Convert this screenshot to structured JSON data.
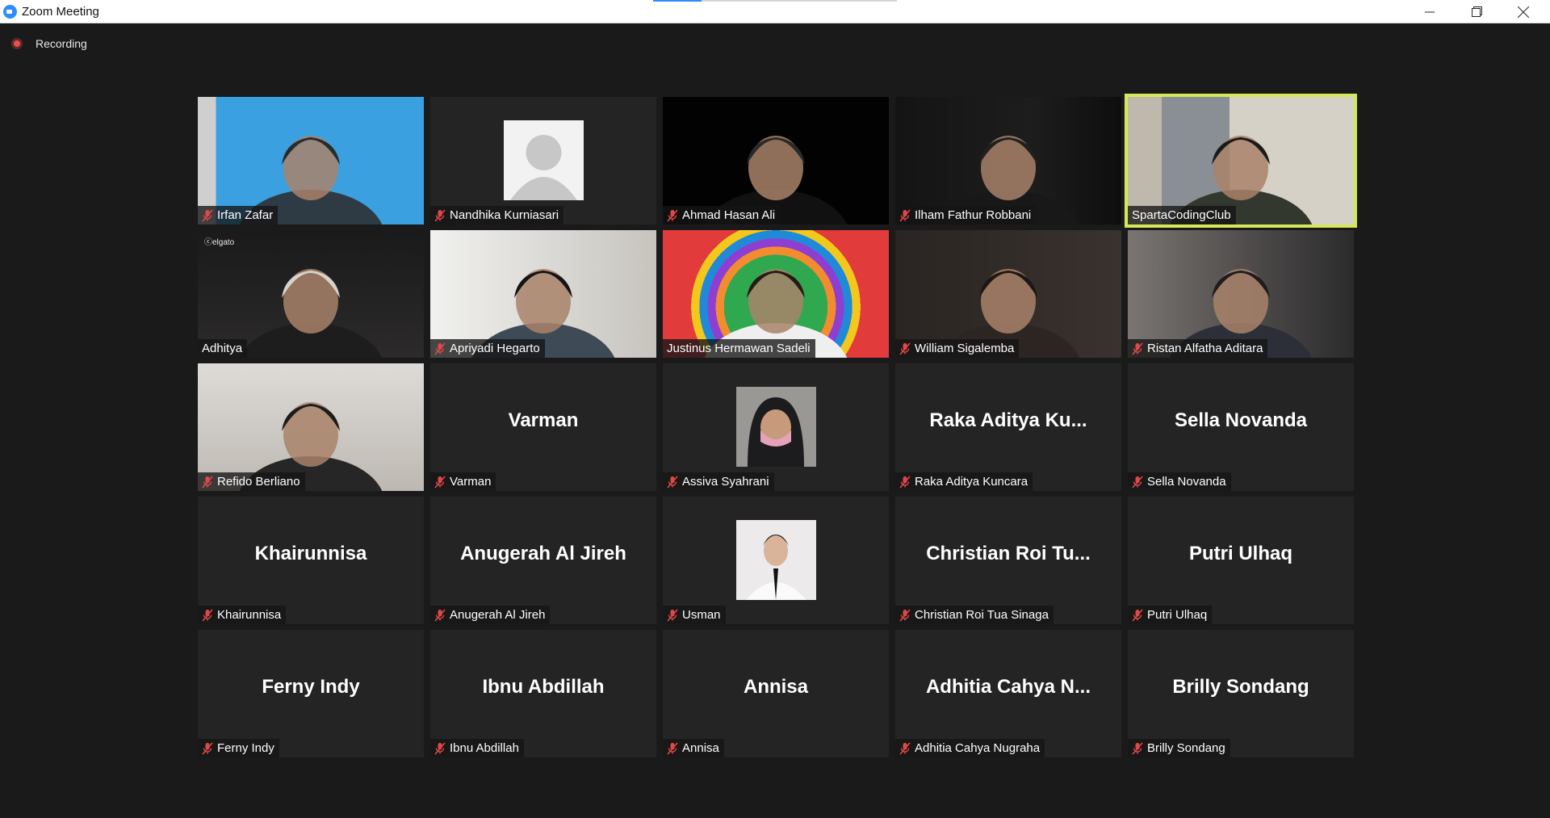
{
  "window": {
    "title": "Zoom Meeting"
  },
  "recording": {
    "label": "Recording"
  },
  "overlay": {
    "brand": "elgato"
  },
  "colors": {
    "active_speaker": "#d6e85a",
    "recording": "#f04d4d",
    "mute": "#e04848"
  },
  "tiles": [
    {
      "name": "Irfan Zafar",
      "muted": true
    },
    {
      "name": "Nandhika Kurniasari",
      "muted": true
    },
    {
      "name": "Ahmad Hasan Ali",
      "muted": true
    },
    {
      "name": "Ilham Fathur Robbani",
      "muted": true
    },
    {
      "name": "SpartaCodingClub",
      "muted": false,
      "active": true
    },
    {
      "name": "Adhitya",
      "muted": false
    },
    {
      "name": "Apriyadi Hegarto",
      "muted": true
    },
    {
      "name": "Justinus Hermawan Sadeli",
      "muted": false
    },
    {
      "name": "William Sigalemba",
      "muted": true
    },
    {
      "name": "Ristan Alfatha Aditara",
      "muted": true
    },
    {
      "name": "Refido Berliano",
      "muted": true
    },
    {
      "name": "Varman",
      "muted": true,
      "display": "Varman"
    },
    {
      "name": "Assiva Syahrani",
      "muted": true
    },
    {
      "name": "Raka Aditya Kuncara",
      "muted": true,
      "display": "Raka  Aditya  Ku..."
    },
    {
      "name": "Sella Novanda",
      "muted": true,
      "display": "Sella Novanda"
    },
    {
      "name": "Khairunnisa",
      "muted": true,
      "display": "Khairunnisa"
    },
    {
      "name": "Anugerah Al Jireh",
      "muted": true,
      "display": "Anugerah Al Jireh"
    },
    {
      "name": "Usman",
      "muted": true
    },
    {
      "name": "Christian Roi Tua Sinaga",
      "muted": true,
      "display": "Christian  Roi  Tu..."
    },
    {
      "name": "Putri Ulhaq",
      "muted": true,
      "display": "Putri Ulhaq"
    },
    {
      "name": "Ferny Indy",
      "muted": true,
      "display": "Ferny Indy"
    },
    {
      "name": "Ibnu Abdillah",
      "muted": true,
      "display": "Ibnu Abdillah"
    },
    {
      "name": "Annisa",
      "muted": true,
      "display": "Annisa"
    },
    {
      "name": "Adhitia Cahya Nugraha",
      "muted": true,
      "display": "Adhitia  Cahya  N..."
    },
    {
      "name": "Brilly Sondang",
      "muted": true,
      "display": "Brilly Sondang"
    }
  ]
}
